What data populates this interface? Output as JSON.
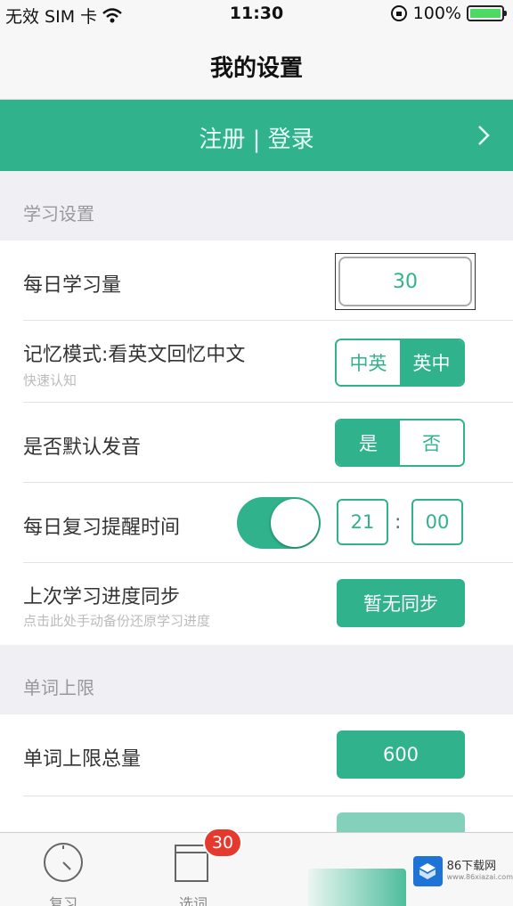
{
  "status_bar": {
    "carrier": "无效 SIM 卡",
    "time": "11:30",
    "battery_percent": "100%",
    "battery_color": "#4cd964"
  },
  "nav": {
    "title": "我的设置"
  },
  "login": {
    "label": "注册 | 登录",
    "chevron_icon": "chevron-right-icon"
  },
  "study_section": {
    "header": "学习设置",
    "daily_amount": {
      "label": "每日学习量",
      "value": "30"
    },
    "memory_mode": {
      "label": "记忆模式:看英文回忆中文",
      "sublabel": "快速认知",
      "options": [
        "中英",
        "英中"
      ],
      "selected": "英中"
    },
    "default_audio": {
      "label": "是否默认发音",
      "options": [
        "是",
        "否"
      ],
      "selected": "是"
    },
    "reminder": {
      "label": "每日复习提醒时间",
      "enabled": true,
      "hour": "21",
      "separator": ":",
      "minute": "00"
    },
    "sync": {
      "label": "上次学习进度同步",
      "sublabel": "点击此处手动备份还原学习进度",
      "button": "暂无同步"
    }
  },
  "word_section": {
    "header": "单词上限",
    "total_limit": {
      "label": "单词上限总量",
      "value": "600"
    }
  },
  "tabbar": {
    "tabs": [
      {
        "label": "复习",
        "icon": "clock-dial-icon"
      },
      {
        "label": "选词",
        "icon": "book-icon",
        "badge": "30"
      }
    ]
  },
  "watermark": {
    "name": "86下载网",
    "sub": "www.86xiazai.com"
  },
  "colors": {
    "accent": "#30b38c",
    "badge": "#e5392e"
  }
}
